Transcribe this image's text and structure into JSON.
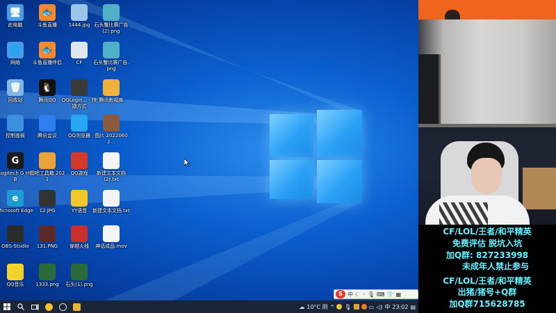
{
  "desktop": {
    "icons": [
      {
        "label": "此电脑",
        "glyph": "🖥",
        "color": "#4a9ce8"
      },
      {
        "label": "斗鱼直播",
        "glyph": "🐟",
        "color": "#f28a2b"
      },
      {
        "label": "1444.jpg",
        "glyph": "",
        "color": "#9bc4e6"
      },
      {
        "label": "石头蟹比赛广告(2).png",
        "glyph": "",
        "color": "#4fb0c8"
      },
      {
        "label": "网络",
        "glyph": "🌐",
        "color": "#4a9ce8"
      },
      {
        "label": "斗鱼直播伴侣",
        "glyph": "🐟",
        "color": "#f28a2b"
      },
      {
        "label": "CF",
        "glyph": "",
        "color": "#dfe8f2"
      },
      {
        "label": "石头蟹比赛广告.png",
        "glyph": "",
        "color": "#4fb0c8"
      },
      {
        "label": "回收站",
        "glyph": "🗑",
        "color": "#7fb6e6"
      },
      {
        "label": "腾讯QQ",
        "glyph": "🐧",
        "color": "#111111"
      },
      {
        "label": "QQLogin... - 快捷方式",
        "glyph": "",
        "color": "#3b3b3b"
      },
      {
        "label": "腾讯影视库",
        "glyph": "",
        "color": "#f2b13a"
      },
      {
        "label": "控制面板",
        "glyph": "",
        "color": "#3d8fe0"
      },
      {
        "label": "腾讯会议",
        "glyph": "",
        "color": "#2f7ef0"
      },
      {
        "label": "QQ浏览器",
        "glyph": "",
        "color": "#2aa7f2"
      },
      {
        "label": "图片 20220602...",
        "glyph": "",
        "color": "#8a5a3a"
      },
      {
        "label": "Logitech G HUB",
        "glyph": "G",
        "color": "#1a1a1a"
      },
      {
        "label": "图吧工具箱 2021",
        "glyph": "",
        "color": "#e8a33b"
      },
      {
        "label": "QQ游戏",
        "glyph": "",
        "color": "#d43a2a"
      },
      {
        "label": "新建文本文档 (2).txt",
        "glyph": "",
        "color": "#f4f4f4"
      },
      {
        "label": "Microsoft Edge",
        "glyph": "e",
        "color": "#1d9ad6"
      },
      {
        "label": "12.JPG",
        "glyph": "",
        "color": "#333333"
      },
      {
        "label": "YY语音",
        "glyph": "",
        "color": "#f5c82a"
      },
      {
        "label": "新建文本文档.txt",
        "glyph": "",
        "color": "#f4f4f4"
      },
      {
        "label": "OBS-Studio",
        "glyph": "",
        "color": "#2b2b2b"
      },
      {
        "label": "131.PNG",
        "glyph": "",
        "color": "#5a2a2a"
      },
      {
        "label": "穿越火线",
        "glyph": "",
        "color": "#c9302c"
      },
      {
        "label": "神话成品.mov",
        "glyph": "",
        "color": "#f4f4f4"
      },
      {
        "label": "QQ音乐",
        "glyph": "",
        "color": "#f2d12a"
      },
      {
        "label": "1333.png",
        "glyph": "",
        "color": "#2a6a3a"
      },
      {
        "label": "石头(1).png",
        "glyph": "",
        "color": "#2a6a3a"
      }
    ]
  },
  "taskbar": {
    "weather": "10°C 阴",
    "time": "23:02"
  },
  "ime": {
    "logo": "S",
    "lang": "中"
  },
  "promo": {
    "line1": "CF/LOL/王者/和平精英",
    "line2": "免费评估   脱坑入坑",
    "line3": "加Q群:  827233998",
    "line4": "未成年人禁止参与",
    "line5": "CF/LOL/王者/和平精英",
    "line6": "出猪/猪号+Q群",
    "line7": "加Q群715628785"
  }
}
